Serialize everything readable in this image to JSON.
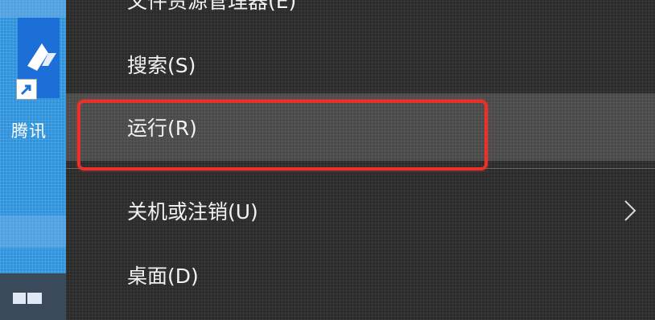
{
  "desktop": {
    "icon_label": "腾讯",
    "app_icon": "tencent-app-icon",
    "shortcut_icon": "shortcut-arrow-icon",
    "taskbar_icon": "windows-start-icon"
  },
  "menu": {
    "items": [
      {
        "label": "文件资源管理器(E)",
        "icon": ""
      },
      {
        "label": "搜索(S)"
      },
      {
        "label": "运行(R)",
        "hovered": true
      },
      {
        "label": "关机或注销(U)",
        "submenu_icon": "chevron-right-icon"
      },
      {
        "label": "桌面(D)"
      }
    ]
  },
  "colors": {
    "menu_bg": "#2b2b2b",
    "hover_bg": "#4a4a4a",
    "annotation_border": "#e8312a",
    "desktop_bg": "#2f93dc"
  }
}
